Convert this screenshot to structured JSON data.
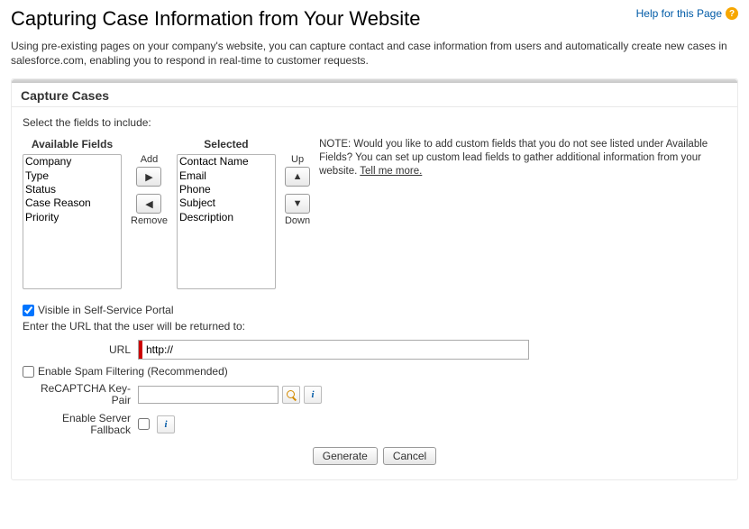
{
  "header": {
    "title": "Capturing Case Information from Your Website",
    "help_link": "Help for this Page",
    "help_icon": "?"
  },
  "intro": "Using pre-existing pages on your company's website, you can capture contact and case information from users and automatically create new cases in salesforce.com, enabling you to respond in real-time to customer requests.",
  "section_title": "Capture Cases",
  "prompt": "Select the fields to include:",
  "lists": {
    "available_label": "Available Fields",
    "available": [
      "Company",
      "Type",
      "Status",
      "Case Reason",
      "Priority"
    ],
    "selected_label": "Selected",
    "selected": [
      "Contact Name",
      "Email",
      "Phone",
      "Subject",
      "Description"
    ]
  },
  "move": {
    "add": "Add",
    "remove": "Remove",
    "up": "Up",
    "down": "Down"
  },
  "note": {
    "text": "NOTE: Would you like to add custom fields that you do not see listed under Available Fields? You can set up custom lead fields to gather additional information from your website. ",
    "link": "Tell me more."
  },
  "visible_label": "Visible in Self-Service Portal",
  "visible_checked": true,
  "return_prompt": "Enter the URL that the user will be returned to:",
  "url": {
    "label": "URL",
    "value": "http://"
  },
  "spam": {
    "label": "Enable Spam Filtering (Recommended)",
    "checked": false
  },
  "recaptcha": {
    "label": "ReCAPTCHA Key-Pair",
    "value": ""
  },
  "fallback": {
    "label": "Enable Server Fallback",
    "checked": false
  },
  "buttons": {
    "generate": "Generate",
    "cancel": "Cancel"
  }
}
